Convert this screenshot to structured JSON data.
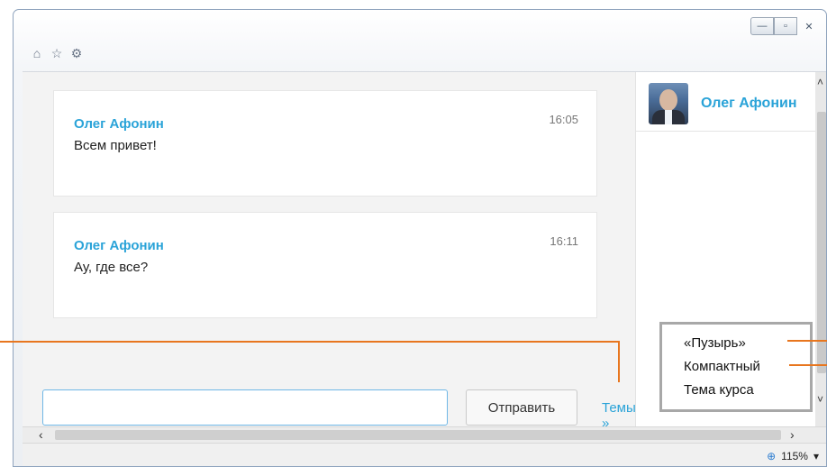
{
  "window": {
    "controls": {
      "minimize": "—",
      "maximize": "▫",
      "close": "✕"
    },
    "toolbar_icons": [
      "home-icon",
      "star-icon",
      "gear-icon"
    ]
  },
  "chat": {
    "messages": [
      {
        "author": "Олег Афонин",
        "text": "Всем привет!",
        "time": "16:05"
      },
      {
        "author": "Олег Афонин",
        "text": "Ау, где все?",
        "time": "16:11"
      }
    ],
    "compose": {
      "input_value": "",
      "send_label": "Отправить",
      "themes_label": "Темы »"
    }
  },
  "sidebar": {
    "users": [
      {
        "name": "Олег Афонин"
      }
    ]
  },
  "theme_menu": {
    "items": [
      "«Пузырь»",
      "Компактный",
      "Тема курса"
    ]
  },
  "statusbar": {
    "zoom": "115%"
  },
  "colors": {
    "accent": "#2aa3d8",
    "callout_line": "#e8761e"
  }
}
